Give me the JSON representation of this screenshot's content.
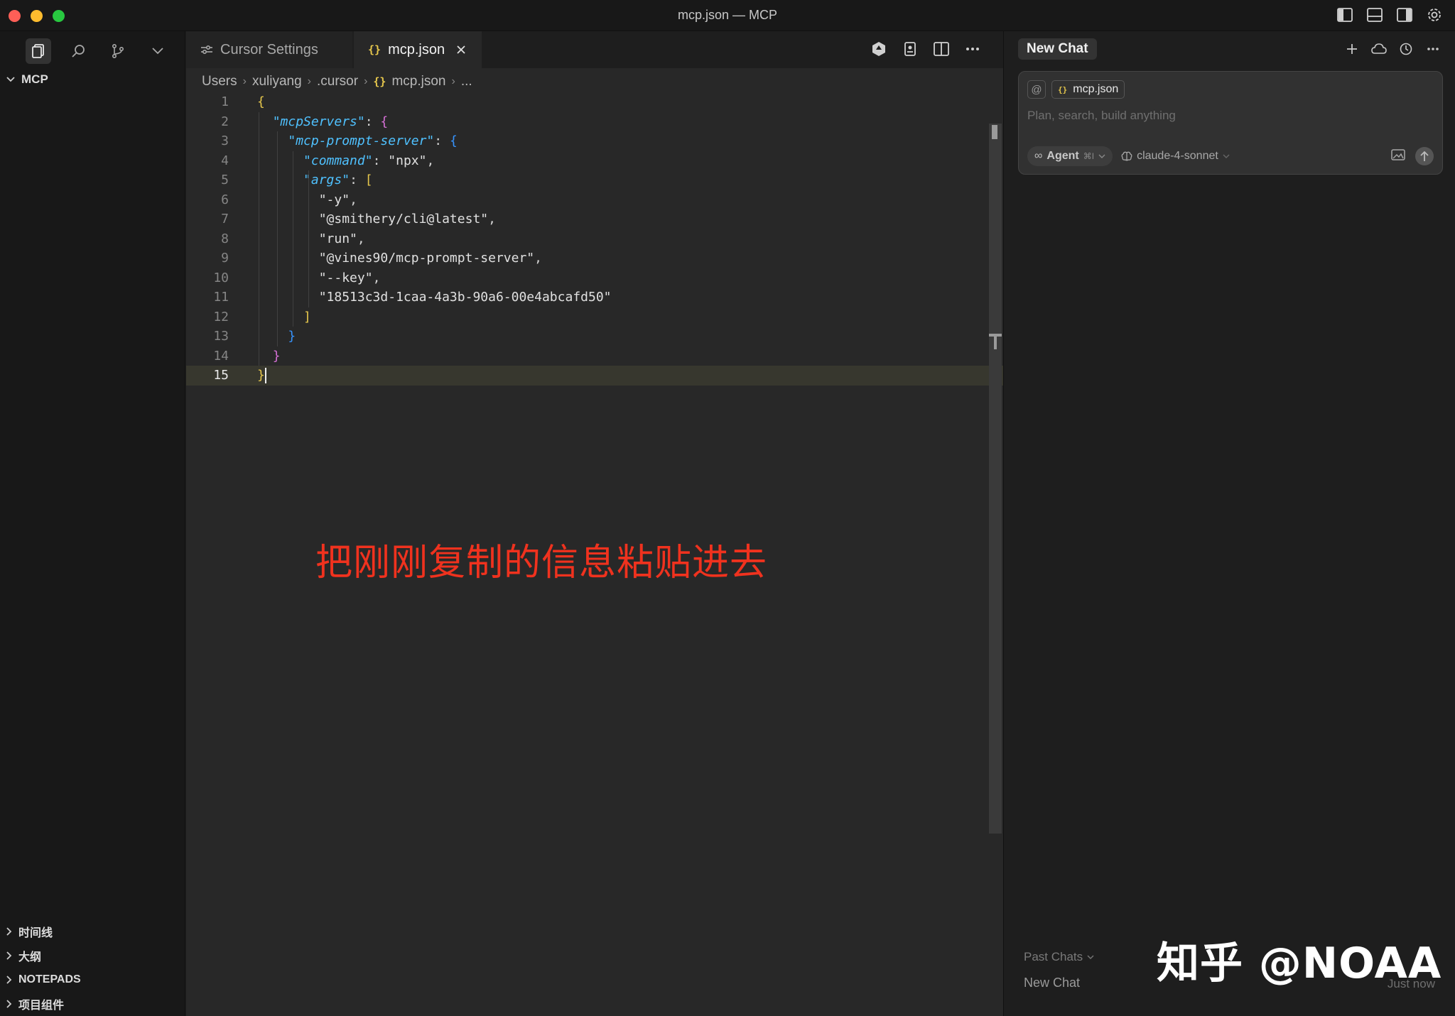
{
  "window": {
    "title": "mcp.json — MCP"
  },
  "sidebar": {
    "header": "MCP",
    "sections": [
      "时间线",
      "大纲",
      "NOTEPADS",
      "项目组件"
    ]
  },
  "tabs": [
    {
      "label": "Cursor Settings",
      "icon": "settings-sliders-icon"
    },
    {
      "label": "mcp.json",
      "icon": "json-braces-icon"
    }
  ],
  "breadcrumb": [
    "Users",
    "xuliyang",
    ".cursor",
    "mcp.json",
    "..."
  ],
  "code": {
    "lines": [
      {
        "n": "1",
        "t": "{"
      },
      {
        "n": "2",
        "t": "  \"mcpServers\": {"
      },
      {
        "n": "3",
        "t": "    \"mcp-prompt-server\": {"
      },
      {
        "n": "4",
        "t": "      \"command\": \"npx\","
      },
      {
        "n": "5",
        "t": "      \"args\": ["
      },
      {
        "n": "6",
        "t": "        \"-y\","
      },
      {
        "n": "7",
        "t": "        \"@smithery/cli@latest\","
      },
      {
        "n": "8",
        "t": "        \"run\","
      },
      {
        "n": "9",
        "t": "        \"@vines90/mcp-prompt-server\","
      },
      {
        "n": "10",
        "t": "        \"--key\","
      },
      {
        "n": "11",
        "t": "        \"18513c3d-1caa-4a3b-90a6-00e4abcafd50\""
      },
      {
        "n": "12",
        "t": "      ]"
      },
      {
        "n": "13",
        "t": "    }"
      },
      {
        "n": "14",
        "t": "  }"
      },
      {
        "n": "15",
        "t": "}"
      }
    ],
    "current_line": "15"
  },
  "annotation": "把刚刚复制的信息粘贴进去",
  "chat": {
    "title": "New Chat",
    "context_file": "mcp.json",
    "at_symbol": "@",
    "placeholder": "Plan, search, build anything",
    "mode": "Agent",
    "mode_shortcut": "⌘I",
    "model": "claude-4-sonnet",
    "past_chats_label": "Past Chats",
    "past_items": [
      {
        "title": "New Chat",
        "time": "Just now"
      }
    ]
  },
  "watermark": "知乎 @NOAA",
  "colors": {
    "accent_annotation": "#f0321e",
    "key": "#4fc1ff",
    "brace1": "#e6c74c",
    "brace2": "#d670d6",
    "brace3": "#3794ff"
  }
}
